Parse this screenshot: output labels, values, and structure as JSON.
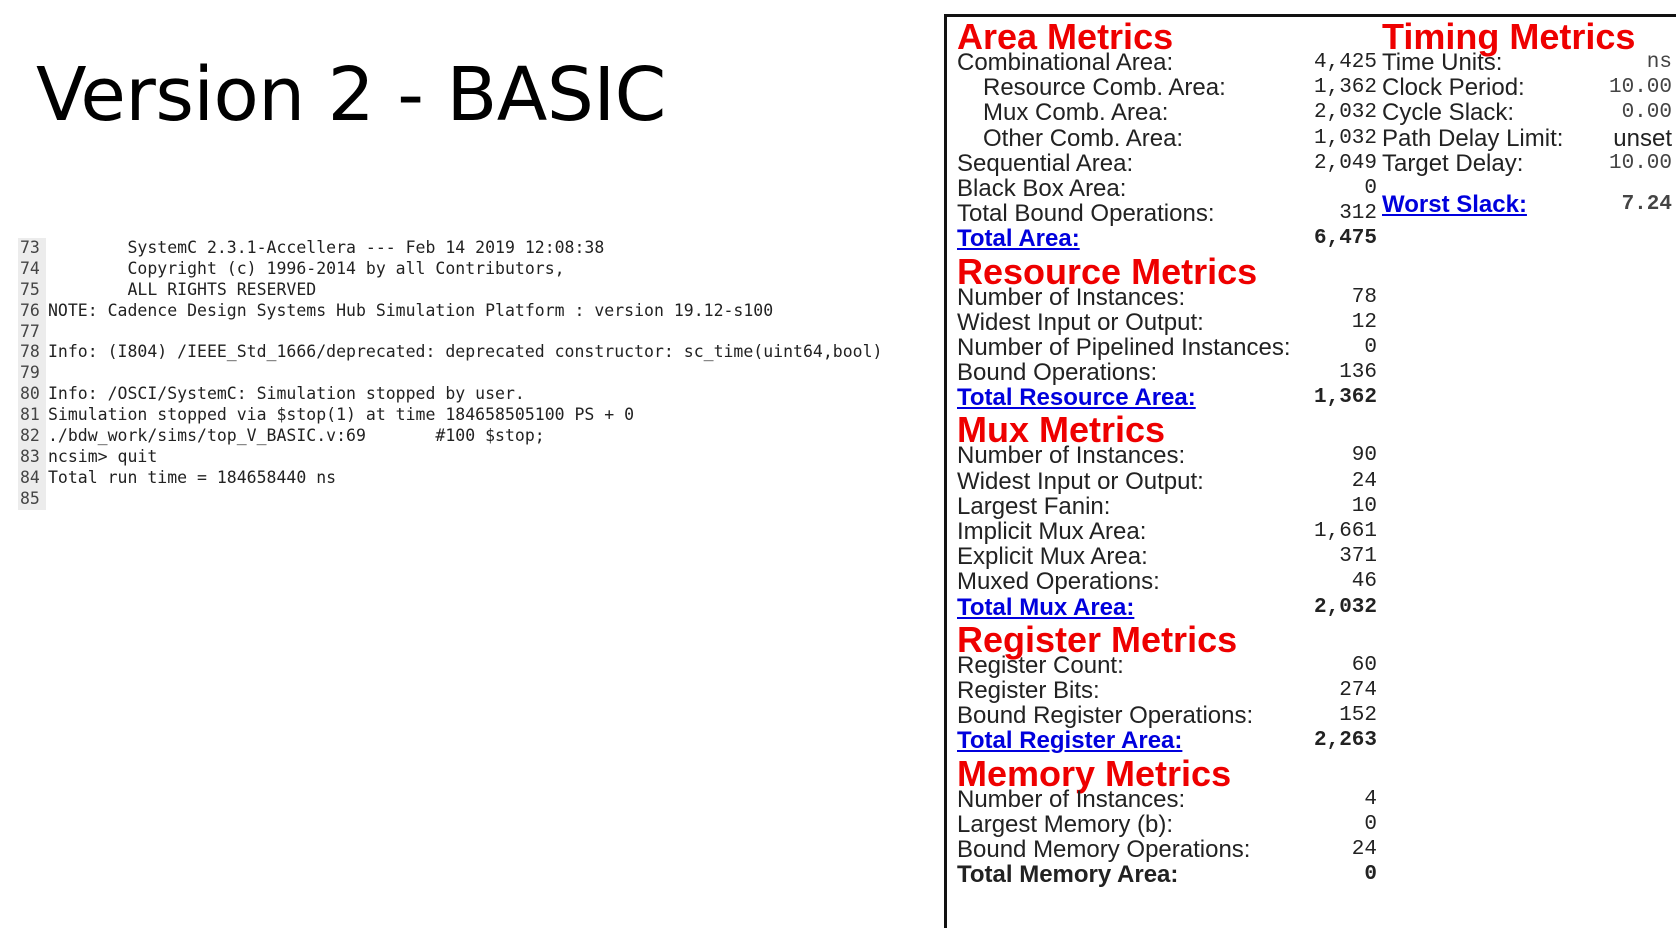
{
  "slide": {
    "title": "Version 2 - BASIC"
  },
  "console": {
    "lines": [
      {
        "num": "73",
        "text": "        SystemC 2.3.1-Accellera --- Feb 14 2019 12:08:38"
      },
      {
        "num": "74",
        "text": "        Copyright (c) 1996-2014 by all Contributors,"
      },
      {
        "num": "75",
        "text": "        ALL RIGHTS RESERVED"
      },
      {
        "num": "76",
        "text": "NOTE: Cadence Design Systems Hub Simulation Platform : version 19.12-s100"
      },
      {
        "num": "77",
        "text": ""
      },
      {
        "num": "78",
        "text": "Info: (I804) /IEEE_Std_1666/deprecated: deprecated constructor: sc_time(uint64,bool)"
      },
      {
        "num": "79",
        "text": ""
      },
      {
        "num": "80",
        "text": "Info: /OSCI/SystemC: Simulation stopped by user."
      },
      {
        "num": "81",
        "text": "Simulation stopped via $stop(1) at time 184658505100 PS + 0"
      },
      {
        "num": "82",
        "text": "./bdw_work/sims/top_V_BASIC.v:69       #100 $stop;"
      },
      {
        "num": "83",
        "text": "ncsim> quit"
      },
      {
        "num": "84",
        "text": "Total run time = 184658440 ns"
      },
      {
        "num": "85",
        "text": ""
      }
    ]
  },
  "report": {
    "area": {
      "title": "Area Metrics",
      "rows": [
        {
          "label": "Combinational Area:",
          "value": "4,425",
          "indent": false
        },
        {
          "label": "Resource Comb. Area:",
          "value": "1,362",
          "indent": true
        },
        {
          "label": "Mux Comb. Area:",
          "value": "2,032",
          "indent": true
        },
        {
          "label": "Other Comb. Area:",
          "value": "1,032",
          "indent": true
        },
        {
          "label": "Sequential Area:",
          "value": "2,049",
          "indent": false
        },
        {
          "label": "Black Box Area:",
          "value": "0",
          "indent": false
        },
        {
          "label": "Total Bound Operations:",
          "value": "312",
          "indent": false
        }
      ],
      "total": {
        "label": "Total Area:",
        "value": "6,475"
      }
    },
    "resource": {
      "title": "Resource Metrics",
      "rows": [
        {
          "label": "Number of Instances:",
          "value": "78"
        },
        {
          "label": "Widest Input or Output:",
          "value": "12"
        },
        {
          "label": "Number of Pipelined Instances:",
          "value": "0"
        },
        {
          "label": "Bound Operations:",
          "value": "136"
        }
      ],
      "total": {
        "label": "Total Resource Area:",
        "value": "1,362"
      }
    },
    "mux": {
      "title": "Mux Metrics",
      "rows": [
        {
          "label": "Number of Instances:",
          "value": "90"
        },
        {
          "label": "Widest Input or Output:",
          "value": "24"
        },
        {
          "label": "Largest Fanin:",
          "value": "10"
        },
        {
          "label": "Implicit Mux Area:",
          "value": "1,661"
        },
        {
          "label": "Explicit Mux Area:",
          "value": "371"
        },
        {
          "label": "Muxed Operations:",
          "value": "46"
        }
      ],
      "total": {
        "label": "Total Mux Area:",
        "value": "2,032"
      }
    },
    "register": {
      "title": "Register Metrics",
      "rows": [
        {
          "label": "Register Count:",
          "value": "60"
        },
        {
          "label": "Register Bits:",
          "value": "274"
        },
        {
          "label": "Bound Register Operations:",
          "value": "152"
        }
      ],
      "total": {
        "label": "Total Register Area:",
        "value": "2,263"
      }
    },
    "memory": {
      "title": "Memory Metrics",
      "rows": [
        {
          "label": "Number of Instances:",
          "value": "4"
        },
        {
          "label": "Largest Memory (b):",
          "value": "0"
        },
        {
          "label": "Bound Memory Operations:",
          "value": "24"
        }
      ],
      "total": {
        "label": "Total Memory Area:",
        "value": "0"
      }
    },
    "timing": {
      "title": "Timing Metrics",
      "rows": [
        {
          "label": "Time Units:",
          "value": "ns"
        },
        {
          "label": "Clock Period:",
          "value": "10.00"
        },
        {
          "label": "Cycle Slack:",
          "value": "0.00"
        },
        {
          "label": "Path Delay Limit:",
          "value": "unset"
        },
        {
          "label": "Target Delay:",
          "value": "10.00"
        }
      ],
      "total": {
        "label": "Worst Slack:",
        "value": "7.24"
      }
    }
  }
}
